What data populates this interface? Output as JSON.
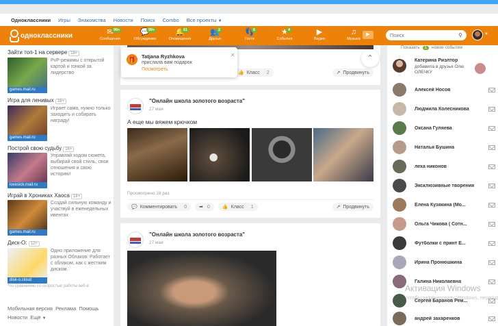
{
  "topnav": {
    "items": [
      "Одноклассники",
      "Игры",
      "Знакомства",
      "Новости",
      "Поиск",
      "Combo",
      "Все проекты"
    ]
  },
  "toolbar": {
    "logo_text": "одноклассники",
    "items": [
      {
        "label": "Сообщения",
        "badge": "99+",
        "icon": "message-icon"
      },
      {
        "label": "Обсуждения",
        "badge": "99+",
        "icon": "discussions-icon"
      },
      {
        "label": "Оповещения",
        "badge": "61",
        "icon": "bell-icon"
      },
      {
        "label": "Друзья",
        "badge": "2",
        "icon": "friends-icon"
      },
      {
        "label": "Гости",
        "badge": "6",
        "icon": "guests-icon"
      },
      {
        "label": "События",
        "badge": "4",
        "icon": "events-icon"
      },
      {
        "label": "Видео",
        "badge": "",
        "icon": "video-icon"
      },
      {
        "label": "Музыка",
        "badge": "",
        "icon": "music-icon"
      }
    ],
    "search_placeholder": "Поиск"
  },
  "left": {
    "promos": [
      {
        "title": "Зайти топ-1 на сервере",
        "age": "18+",
        "caption": "games.mail.ru",
        "desc": "PvP-режимы с открытой картой и гонкой за лидерство",
        "color": "#3b7a3b"
      },
      {
        "title": "Игра для ленивых",
        "age": "18+",
        "caption": "games.mail.ru",
        "desc": "Играет сама, нужно только заходить и собирать награду!",
        "color": "#6a4a8a"
      },
      {
        "title": "Построй свою судьбу",
        "age": "16+",
        "caption": "lovesick.mail.ru",
        "desc": "Управляй ходом сюжета, выбирай свой стиль, свои отношения и свою историю!",
        "color": "#c45a7a"
      },
      {
        "title": "Играй в Хрониках Хаоса",
        "age": "18+",
        "caption": "games.mail.ru",
        "desc": "Создай сильную команду и участвуй в еженедельных ивентах",
        "color": "#8a5a2a"
      },
      {
        "title": "Диск-О:",
        "age": "12+",
        "caption": "disk-o.cloud",
        "desc": "Одно приложение для разных Облаков. Работает с облаком, как с жестким диском.",
        "color": "#3a8ad0"
      }
    ],
    "note": "*по сравнению со скоростью работы веб-в",
    "footer": [
      "Мобильная версия",
      "Реклама",
      "Помощь",
      "Новости",
      "Ещё"
    ]
  },
  "notification": {
    "name": "Tatjana Ryzhkova",
    "text": "прислала вам подарок",
    "link": "Посмотреть"
  },
  "feed": {
    "post0": {
      "like_label": "Класс",
      "like_count": "2",
      "share_label": "Продвинуть"
    },
    "post1": {
      "group": "\"Онлайн школа золотого возраста\"",
      "date": "27 мая",
      "text": "А еще мы вяжем крючком",
      "views": "Просмотрено 18 раз",
      "comment_label": "Комментировать",
      "comment_count": "0",
      "share_count": "0",
      "like_label": "Класс",
      "like_count": "1",
      "promote_label": "Продвинуть"
    },
    "post2": {
      "group": "\"Онлайн школа золотого возраста\"",
      "date": "27 мая"
    }
  },
  "right": {
    "header_show": "Показать",
    "header_count": "1",
    "header_new": "новое событие",
    "event": {
      "name": "Катерина Риэлтор",
      "desc": "добавила в друзья Олю ОЛЕЧКУ"
    },
    "friends": [
      "Алексей Носов",
      "Людмила Колесникова",
      "Оксана Гуляева",
      "Наталья Бушина",
      "леха никонов",
      "Эксклюзивные творения",
      "Елена Кузякина (Мо...",
      "Ольга Чикова ( Сотн...",
      "Футболки с принт Е...",
      "Ирина Пронюшкина",
      "Галина Николаевна",
      "Сергей Баранов Рем...",
      "андрей захаренков"
    ]
  },
  "watermark": {
    "title": "Активация Windows",
    "sub": "Чтобы активировать Windows, перейдите в раздел \"Параметры\"."
  }
}
